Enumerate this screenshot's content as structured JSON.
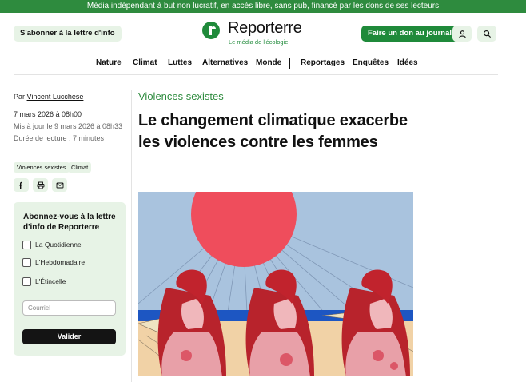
{
  "banner": {
    "text": "Média indépendant à but non lucratif, en accès libre, sans pub, financé par les dons de ses lecteurs"
  },
  "header": {
    "subscribe_label": "S'abonner à la lettre d'info",
    "logo": {
      "name": "Reporterre",
      "tagline": "Le média de l'écologie"
    },
    "donate_label": "Faire un don au journal",
    "account_icon": "user-icon",
    "search_icon": "search-icon"
  },
  "nav": {
    "items": [
      "Nature",
      "Climat",
      "Luttes",
      "Alternatives",
      "Monde",
      "Reportages",
      "Enquêtes",
      "Idées"
    ]
  },
  "article": {
    "byline_prefix": "Par",
    "author": "Vincent Lucchese",
    "published": "7 mars 2026 à 08h00",
    "updated": "Mis à jour le 9 mars 2026 à 08h33",
    "reading_time": "Durée de lecture : 7 minutes",
    "tags": [
      "Violences sexistes",
      "Climat"
    ],
    "category": "Violences sexistes",
    "title": "Le changement climatique exacerbe les violences contre les femmes",
    "share_icons": [
      "facebook-icon",
      "print-icon",
      "mail-icon"
    ]
  },
  "newsletter": {
    "title": "Abonnez-vous à la lettre d'info de Reporterre",
    "options": [
      "La Quotidienne",
      "L'Hebdomadaire",
      "L'Étincelle"
    ],
    "email_placeholder": "Courriel",
    "submit_label": "Valider"
  },
  "colors": {
    "brand_green": "#1f8a3a",
    "light_green": "#e7f3e6",
    "banner_green": "#2e8b3e"
  }
}
